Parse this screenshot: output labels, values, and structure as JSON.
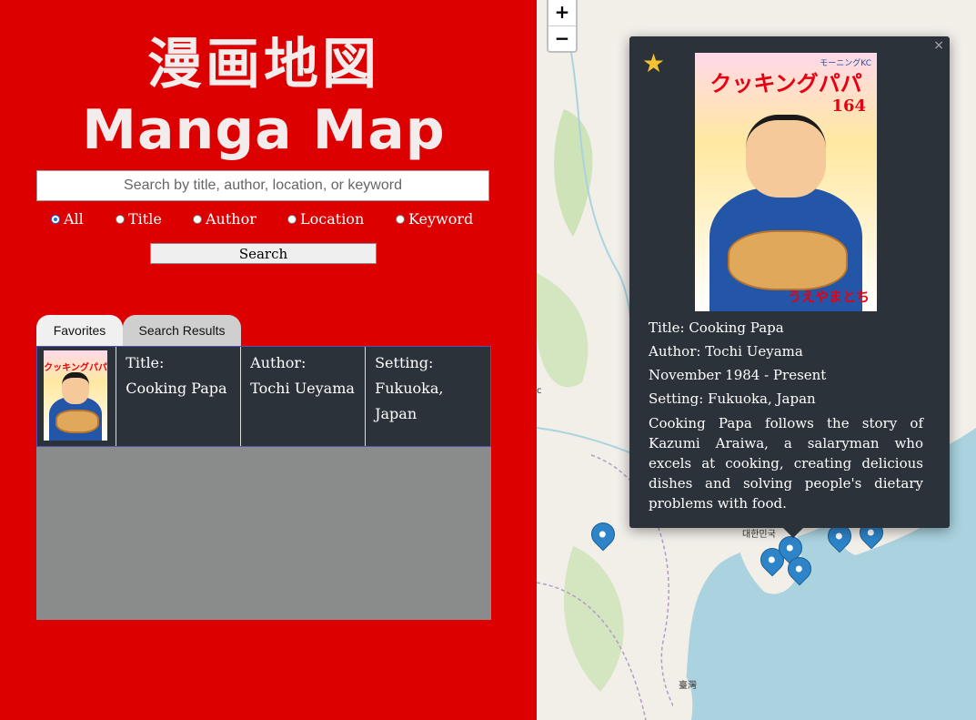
{
  "app": {
    "logo_jp": "漫画地図",
    "logo_en": "Manga Map"
  },
  "search": {
    "placeholder": "Search by title, author, location, or keyword",
    "button_label": "Search",
    "filters": [
      {
        "label": "All",
        "selected": true
      },
      {
        "label": "Title",
        "selected": false
      },
      {
        "label": "Author",
        "selected": false
      },
      {
        "label": "Location",
        "selected": false
      },
      {
        "label": "Keyword",
        "selected": false
      }
    ]
  },
  "tabs": [
    {
      "label": "Favorites"
    },
    {
      "label": "Search Results"
    }
  ],
  "results": [
    {
      "title_label": "Title:",
      "title": "Cooking Papa",
      "author_label": "Author:",
      "author": "Tochi Ueyama",
      "setting_label": "Setting:",
      "setting": "Fukuoka, Japan"
    }
  ],
  "cover": {
    "title_jp": "クッキングパパ",
    "volume": "164",
    "publisher": "モーニングKC",
    "author_jp": "うえやまとち"
  },
  "map": {
    "zoom_in": "+",
    "zoom_out": "−",
    "labels": [
      "대한민국",
      "臺灣",
      "c"
    ]
  },
  "popup": {
    "close": "×",
    "favorite_icon": "star-icon",
    "title": "Title: Cooking Papa",
    "author": "Author: Tochi Ueyama",
    "dates": "November 1984 - Present",
    "setting": "Setting: Fukuoka, Japan",
    "description": "Cooking Papa follows the story of Kazumi Araiwa, a salaryman who excels at cooking, creating delicious dishes and solving people's dietary problems with food."
  },
  "colors": {
    "primary_red": "#dd0000",
    "panel_dark": "#2b323a",
    "sea": "#aad3df",
    "marker_blue": "#2d84c9",
    "star": "#f4c430"
  }
}
